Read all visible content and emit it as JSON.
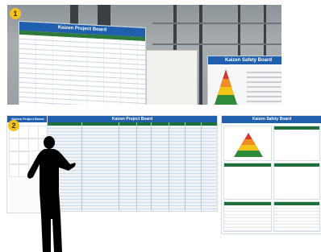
{
  "section_badges": [
    "1",
    "2"
  ],
  "photo": {
    "project_board_title": "Kaizen Project Board",
    "safety_board_title": "Kaizen Safety Board"
  },
  "diagram": {
    "project_board_title": "Kaizen Project Board",
    "safety_board_title": "Kaizen Safety Board",
    "left_board_title": "Kaizen Project Board"
  },
  "colors": {
    "header_blue": "#1f5fae",
    "column_green": "#1f6f3a",
    "badge_yellow": "#f3c31a"
  }
}
